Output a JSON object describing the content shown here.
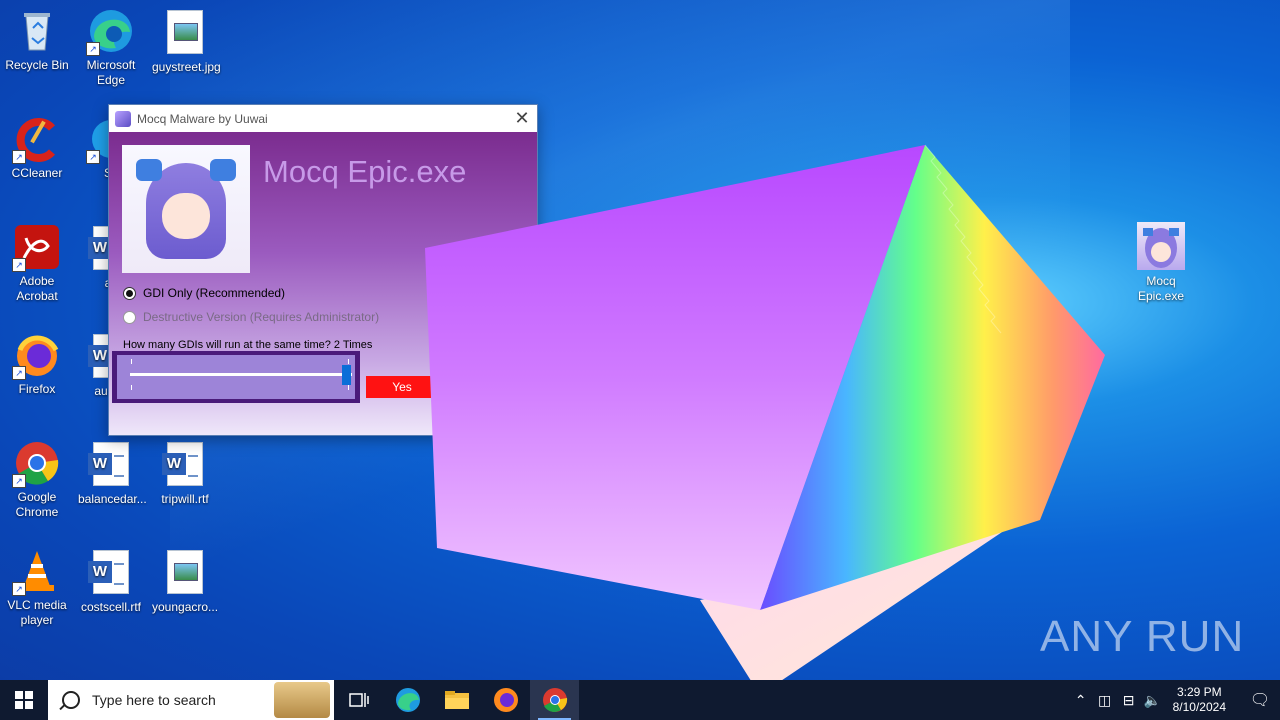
{
  "desktop": {
    "icons": [
      {
        "label": "Recycle Bin"
      },
      {
        "label": "Microsoft Edge"
      },
      {
        "label": "guystreet.jpg"
      },
      {
        "label": "CCleaner"
      },
      {
        "label": "Sk"
      },
      {
        "label": "Adobe Acrobat"
      },
      {
        "label": "ati"
      },
      {
        "label": "Firefox"
      },
      {
        "label": "austra"
      },
      {
        "label": "Google Chrome"
      },
      {
        "label": "balancedar..."
      },
      {
        "label": "tripwill.rtf"
      },
      {
        "label": "VLC media player"
      },
      {
        "label": "costscell.rtf"
      },
      {
        "label": "youngacro..."
      },
      {
        "label": "Mocq Epic.exe"
      }
    ]
  },
  "dialog": {
    "title": "Mocq Malware by Uuwai",
    "close_glyph": "✕",
    "app_title": "Mocq Epic.exe",
    "option_gdi": "GDI Only (Recommended)",
    "option_destructive": "Destructive Version (Requires Administrator)",
    "question": "How many GDIs will run at the same time? 2 Times",
    "slider_level": 1.0,
    "yes_label": "Yes"
  },
  "watermark": "ANY RUN",
  "taskbar": {
    "search_placeholder": "Type here to search",
    "time": "3:29 PM",
    "date": "8/10/2024"
  }
}
